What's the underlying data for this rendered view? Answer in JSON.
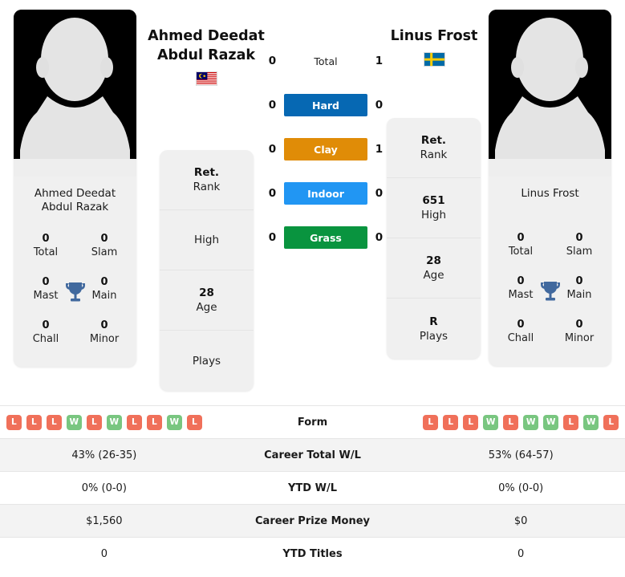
{
  "players": {
    "left": {
      "name": "Ahmed Deedat Abdul Razak",
      "display_name_line1": "Ahmed Deedat",
      "display_name_line2": "Abdul Razak",
      "country": "Malaysia",
      "flag_icon": "flag-malaysia",
      "avatar_icon": "player-silhouette-avatar",
      "titles": {
        "total_value": "0",
        "total_label": "Total",
        "slam_value": "0",
        "slam_label": "Slam",
        "mast_value": "0",
        "mast_label": "Mast",
        "main_value": "0",
        "main_label": "Main",
        "chall_value": "0",
        "chall_label": "Chall",
        "minor_value": "0",
        "minor_label": "Minor",
        "trophy_icon": "trophy-icon"
      },
      "info": [
        {
          "value": "Ret.",
          "label": "Rank"
        },
        {
          "value": "",
          "label": "High"
        },
        {
          "value": "28",
          "label": "Age"
        },
        {
          "value": "",
          "label": "Plays"
        }
      ],
      "form": [
        "L",
        "L",
        "L",
        "W",
        "L",
        "W",
        "L",
        "L",
        "W",
        "L"
      ],
      "career_total_wl": "43% (26-35)",
      "ytd_wl": "0% (0-0)",
      "career_prize_money": "$1,560",
      "ytd_titles": "0"
    },
    "right": {
      "name": "Linus Frost",
      "display_name_line1": "Linus Frost",
      "display_name_line2": "",
      "country": "Sweden",
      "flag_icon": "flag-sweden",
      "avatar_icon": "player-silhouette-avatar",
      "titles": {
        "total_value": "0",
        "total_label": "Total",
        "slam_value": "0",
        "slam_label": "Slam",
        "mast_value": "0",
        "mast_label": "Mast",
        "main_value": "0",
        "main_label": "Main",
        "chall_value": "0",
        "chall_label": "Chall",
        "minor_value": "0",
        "minor_label": "Minor",
        "trophy_icon": "trophy-icon"
      },
      "info": [
        {
          "value": "Ret.",
          "label": "Rank"
        },
        {
          "value": "651",
          "label": "High"
        },
        {
          "value": "28",
          "label": "Age"
        },
        {
          "value": "R",
          "label": "Plays"
        }
      ],
      "form": [
        "L",
        "L",
        "L",
        "W",
        "L",
        "W",
        "W",
        "L",
        "W",
        "L"
      ],
      "career_total_wl": "53% (64-57)",
      "ytd_wl": "0% (0-0)",
      "career_prize_money": "$0",
      "ytd_titles": "0"
    }
  },
  "head_to_head": {
    "rows": [
      {
        "label": "Total",
        "left": "0",
        "right": "1",
        "color": "",
        "style": "plain"
      },
      {
        "label": "Hard",
        "left": "0",
        "right": "0",
        "color": "#0668b3",
        "style": "pill"
      },
      {
        "label": "Clay",
        "left": "0",
        "right": "1",
        "color": "#e08c07",
        "style": "pill"
      },
      {
        "label": "Indoor",
        "left": "0",
        "right": "0",
        "color": "#2196f3",
        "style": "pill"
      },
      {
        "label": "Grass",
        "left": "0",
        "right": "0",
        "color": "#09943f",
        "style": "pill"
      }
    ]
  },
  "stats_table": {
    "rows": [
      {
        "label": "Form",
        "type": "form",
        "left": "",
        "right": ""
      },
      {
        "label": "Career Total W/L",
        "type": "text",
        "left": "43% (26-35)",
        "right": "53% (64-57)"
      },
      {
        "label": "YTD W/L",
        "type": "text",
        "left": "0% (0-0)",
        "right": "0% (0-0)"
      },
      {
        "label": "Career Prize Money",
        "type": "text",
        "left": "$1,560",
        "right": "$0"
      },
      {
        "label": "YTD Titles",
        "type": "text",
        "left": "0",
        "right": "0"
      }
    ]
  },
  "colors": {
    "win_badge": "#79c680",
    "loss_badge": "#f0705a",
    "hard": "#0668b3",
    "clay": "#e08c07",
    "indoor": "#2196f3",
    "grass": "#09943f",
    "card_bg": "#f0f0f0",
    "alt_row_bg": "#f3f3f3"
  }
}
